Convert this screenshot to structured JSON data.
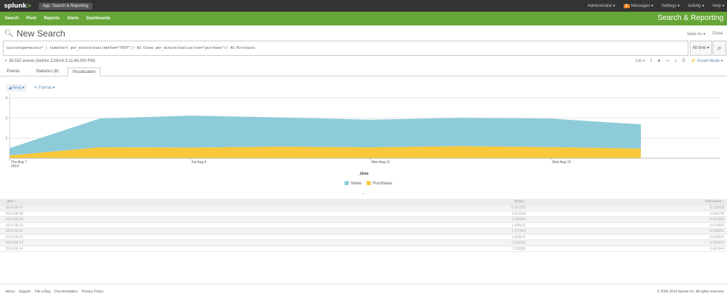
{
  "system_bar": {
    "logo": "splunk",
    "app_menu": "App: Search & Reporting",
    "admin": "Administrator",
    "messages_count": "1",
    "messages": "Messages",
    "settings": "Settings",
    "activity": "Activity",
    "help": "Help"
  },
  "app_bar": {
    "nav": [
      "Search",
      "Pivot",
      "Reports",
      "Alerts",
      "Dashboards"
    ],
    "title": "Search & Reporting"
  },
  "search": {
    "title": "New Search",
    "save_as": "Save As",
    "close": "Close",
    "query": "sourcetype=access* | timechart per_minute(eval(method=\"POST\")) AS Views per_minute(eval(action=\"purchase\")) AS Purchases",
    "time_range": "All time",
    "status": "✓ 39,532 events (before 12/6/14 3:11:48.000 PM)",
    "job_label": "Job",
    "smart_mode": "Smart Mode"
  },
  "tabs": [
    "Events",
    "Statistics (8)",
    "Visualization"
  ],
  "active_tab": "Visualization",
  "viz_toolbar": {
    "type": "Area",
    "format": "Format"
  },
  "chart_data": {
    "type": "area",
    "stacked": true,
    "x": [
      "2014-08-07",
      "2014-08-08",
      "2014-08-09",
      "2014-08-10",
      "2014-08-11",
      "2014-08-12",
      "2014-08-13",
      "2014-08-14"
    ],
    "tick_labels": [
      "Thu Aug 7\n2014",
      "Sat Aug 9",
      "Mon Aug 11",
      "Wed Aug 13"
    ],
    "xlabel": "_time",
    "ylim": [
      0,
      3
    ],
    "y_ticks": [
      "1",
      "2",
      "3"
    ],
    "series": [
      {
        "name": "Purchases",
        "color": "#f8c93d",
        "values": [
          0.135,
          0.547,
          0.527,
          0.576,
          0.542,
          0.596,
          0.555,
          0.481
        ]
      },
      {
        "name": "Views",
        "color": "#8ecbd9",
        "values": [
          0.368,
          1.422,
          1.586,
          1.449,
          1.372,
          1.409,
          1.411,
          1.196
        ]
      }
    ],
    "legend": [
      "Views",
      "Purchases"
    ],
    "legend_position": "bottom",
    "grid": true
  },
  "table": {
    "headers": [
      "_time",
      "Views",
      "Purchases"
    ],
    "rows": [
      [
        "2014-08-07",
        "0.367222",
        "0.135028"
      ],
      [
        "2014-08-08",
        "1.421528",
        "0.546736"
      ],
      [
        "2014-08-09",
        "1.585694",
        "0.527083"
      ],
      [
        "2014-08-10",
        "1.448611",
        "0.575694"
      ],
      [
        "2014-08-11",
        "1.371944",
        "0.542361"
      ],
      [
        "2014-08-12",
        "1.408611",
        "0.595694"
      ],
      [
        "2014-08-13",
        "1.411111",
        "0.555472"
      ],
      [
        "2014-08-14",
        "1.195556",
        "0.481944"
      ]
    ]
  },
  "footer": {
    "links": [
      "About",
      "Support",
      "File a Bug",
      "Documentation",
      "Privacy Policy"
    ],
    "copyright": "© 2005-2014 Splunk Inc. All rights reserved."
  }
}
